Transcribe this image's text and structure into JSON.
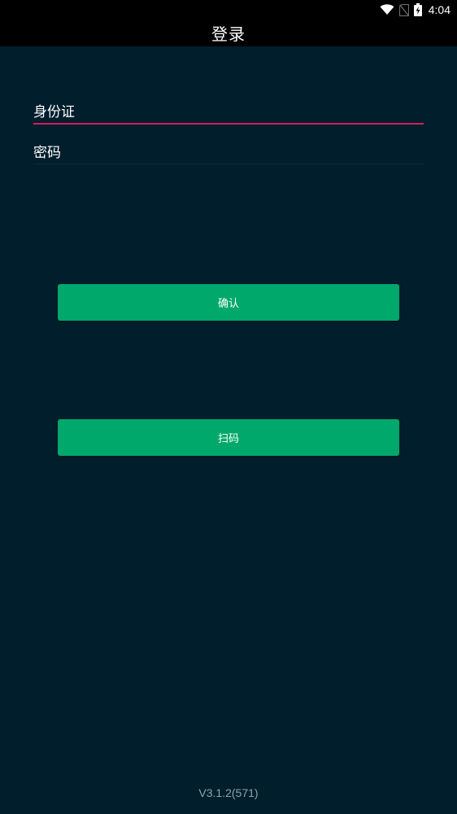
{
  "status_bar": {
    "time": "4:04",
    "icons": [
      "wifi-icon",
      "no-sim-icon",
      "battery-charging-icon"
    ]
  },
  "header": {
    "title": "登录"
  },
  "form": {
    "id_field": {
      "value": "身份证"
    },
    "password_field": {
      "value": "密码"
    }
  },
  "buttons": {
    "confirm_label": "确认",
    "scan_label": "扫码"
  },
  "footer": {
    "version": "V3.1.2(571)"
  },
  "colors": {
    "background": "#011e2c",
    "bar": "#000000",
    "accent_underline": "#d81b60",
    "button": "#00a86b"
  }
}
